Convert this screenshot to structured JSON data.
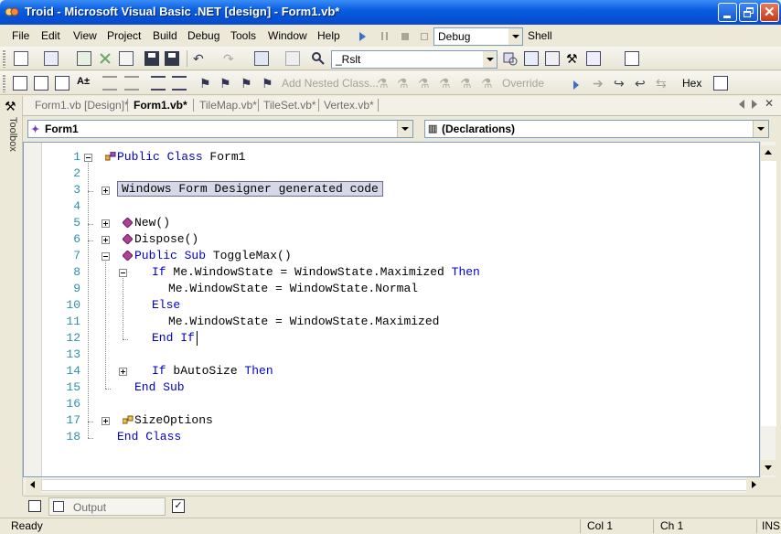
{
  "window": {
    "title": "Troid - Microsoft Visual Basic .NET [design] - Form1.vb*"
  },
  "menu": [
    "File",
    "Edit",
    "View",
    "Project",
    "Build",
    "Debug",
    "Tools",
    "Window",
    "Help"
  ],
  "toolbar": {
    "config_value": "Debug",
    "shell_label": "Shell",
    "find_value": "_Rslt",
    "add_nested_class_label": "Add Nested Class...",
    "override_label": "Override",
    "hex_label": "Hex"
  },
  "tabs": [
    "Form1.vb [Design]*",
    "Form1.vb*",
    "TileMap.vb*",
    "TileSet.vb*",
    "Vertex.vb*"
  ],
  "active_tab": "Form1.vb*",
  "toolbox_label": "Toolbox",
  "editor": {
    "class_combo": "Form1",
    "member_combo": "(Declarations)",
    "lines": [
      {
        "n": "1",
        "segs": [
          {
            "t": "Public Class ",
            "k": 1
          },
          {
            "t": "Form1",
            "k": 0
          }
        ]
      },
      {
        "n": "2",
        "segs": []
      },
      {
        "n": "3",
        "segs": [
          {
            "t": "Windows Form Designer generated code",
            "k": 0
          }
        ],
        "region": true
      },
      {
        "n": "4",
        "segs": []
      },
      {
        "n": "5",
        "segs": [
          {
            "t": "New()",
            "k": 0
          }
        ]
      },
      {
        "n": "6",
        "segs": [
          {
            "t": "Dispose()",
            "k": 0
          }
        ]
      },
      {
        "n": "7",
        "segs": [
          {
            "t": "Public Sub ",
            "k": 1
          },
          {
            "t": "ToggleMax()",
            "k": 0
          }
        ]
      },
      {
        "n": "8",
        "segs": [
          {
            "t": "If ",
            "k": 1
          },
          {
            "t": "Me.WindowState = WindowState.Maximized ",
            "k": 0
          },
          {
            "t": "Then",
            "k": 1
          }
        ]
      },
      {
        "n": "9",
        "segs": [
          {
            "t": "Me.WindowState = WindowState.Normal",
            "k": 0
          }
        ]
      },
      {
        "n": "10",
        "segs": [
          {
            "t": "Else",
            "k": 1
          }
        ]
      },
      {
        "n": "11",
        "segs": [
          {
            "t": "Me.WindowState = WindowState.Maximized",
            "k": 0
          }
        ]
      },
      {
        "n": "12",
        "segs": [
          {
            "t": "End If",
            "k": 1
          }
        ]
      },
      {
        "n": "13",
        "segs": []
      },
      {
        "n": "14",
        "segs": [
          {
            "t": "If ",
            "k": 1
          },
          {
            "t": "bAutoSize ",
            "k": 0
          },
          {
            "t": "Then",
            "k": 1
          }
        ]
      },
      {
        "n": "15",
        "segs": [
          {
            "t": "End Sub",
            "k": 1
          }
        ]
      },
      {
        "n": "16",
        "segs": []
      },
      {
        "n": "17",
        "segs": [
          {
            "t": "SizeOptions",
            "k": 0
          }
        ]
      },
      {
        "n": "18",
        "segs": [
          {
            "t": "End Class",
            "k": 1
          }
        ]
      }
    ]
  },
  "bottom": {
    "output_label": "Output"
  },
  "status": {
    "left": "Ready",
    "col": "Col 1",
    "ch": "Ch 1",
    "ins": "INS"
  },
  "colors": {
    "keyword": "#0000cc",
    "line_number": "#2b91af",
    "titlebar": "#0a5fe0"
  }
}
